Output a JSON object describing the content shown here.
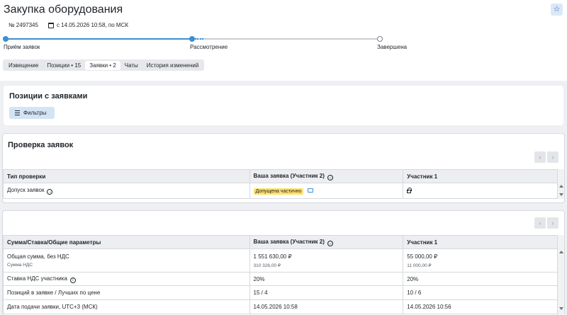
{
  "header": {
    "title": "Закупка оборудования",
    "number": "№ 2497345",
    "date": "с 14.05.2026 10:58, по МСК",
    "favorite_icon": "star-icon"
  },
  "stages": [
    {
      "label": "Приём заявок",
      "state": "done"
    },
    {
      "label": "Рассмотрение",
      "state": "current"
    },
    {
      "label": "Завершена",
      "state": "todo"
    }
  ],
  "tabs": [
    {
      "label": "Извещение",
      "active": false
    },
    {
      "label": "Позиции • 15",
      "active": false
    },
    {
      "label": "Заявки • 2",
      "active": true
    },
    {
      "label": "Чаты",
      "active": false
    },
    {
      "label": "История изменений",
      "active": false
    }
  ],
  "positions": {
    "title": "Позиции с заявками",
    "filter_label": "Фильтры"
  },
  "check": {
    "title": "Проверка заявок",
    "headers": [
      "Тип проверки",
      "Ваша заявка (Участник 2)",
      "Участник 1"
    ],
    "row": {
      "label": "Допуск заявок",
      "status": "Допущена частично"
    }
  },
  "summary": {
    "headers": [
      "Сумма/Ставка/Общие параметры",
      "Ваша заявка (Участник 2)",
      "Участник 1"
    ],
    "rows": [
      {
        "label": "Общая сумма, без НДС",
        "sublabel": "Сумма НДС",
        "mine": "1 551 630,00 ₽",
        "mine_sub": "310 326,00 ₽",
        "other": "55 000,00 ₽",
        "other_sub": "11 000,00 ₽"
      },
      {
        "label": "Ставка НДС участника",
        "mine": "20%",
        "other": "20%"
      },
      {
        "label": "Позиций в заявке / Лучших по цене",
        "mine": "15 / 4",
        "other": "10 / 6"
      },
      {
        "label": "Дата подачи заявки, UTC+3 (МСК)",
        "mine": "14.05.2026 10:58",
        "other": "14.05.2026 10:56"
      }
    ]
  },
  "colors": {
    "accent": "#3b8ed4",
    "badge": "#ffe16a",
    "filter_button": "#d3e4f5"
  }
}
